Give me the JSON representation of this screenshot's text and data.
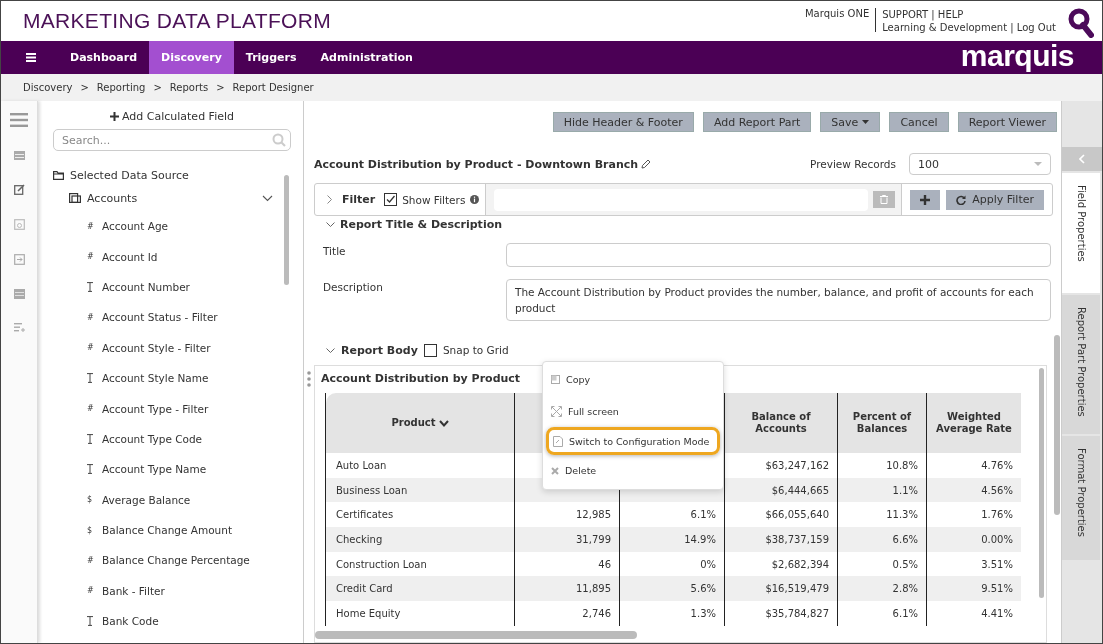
{
  "header": {
    "title": "MARKETING DATA PLATFORM",
    "user": "Marquis ONE",
    "links_top": "SUPPORT | HELP",
    "links_bottom": "Learning & Development | Log Out"
  },
  "nav": {
    "items": [
      {
        "label": "Dashboard",
        "selected": false
      },
      {
        "label": "Discovery",
        "selected": true
      },
      {
        "label": "Triggers",
        "selected": false
      },
      {
        "label": "Administration",
        "selected": false
      }
    ],
    "brand": "marquis"
  },
  "breadcrumb": [
    "Discovery",
    ">",
    "Reporting",
    ">",
    "Reports",
    ">",
    "Report Designer"
  ],
  "field_panel": {
    "add_button": "Add Calculated Field",
    "search": {
      "placeholder": "Search..."
    },
    "root": "Selected Data Source",
    "tables": [
      {
        "label": "Accounts",
        "expanded": true,
        "children": [
          {
            "icon": "#",
            "label": "Account Age",
            "kind": "symbol"
          },
          {
            "icon": "#",
            "label": "Account Id",
            "kind": "symbol"
          },
          {
            "label": "Account Number",
            "kind": "text"
          },
          {
            "icon": "#",
            "label": "Account Status - Filter",
            "kind": "symbol"
          },
          {
            "icon": "#",
            "label": "Account Style - Filter",
            "kind": "symbol"
          },
          {
            "label": "Account Style Name",
            "kind": "text"
          },
          {
            "icon": "#",
            "label": "Account Type - Filter",
            "kind": "symbol"
          },
          {
            "label": "Account Type Code",
            "kind": "text"
          },
          {
            "label": "Account Type Name",
            "kind": "text"
          },
          {
            "icon": "$",
            "label": "Average Balance",
            "kind": "symbol"
          },
          {
            "icon": "$",
            "label": "Balance Change Amount",
            "kind": "symbol"
          },
          {
            "icon": "#",
            "label": "Balance Change Percentage",
            "kind": "symbol"
          },
          {
            "icon": "#",
            "label": "Bank - Filter",
            "kind": "symbol"
          },
          {
            "label": "Bank Code",
            "kind": "text"
          }
        ]
      }
    ]
  },
  "toolbar": [
    "Hide Header & Footer",
    "Add Report Part",
    "Save",
    "Cancel",
    "Report Viewer"
  ],
  "report": {
    "name": "Account Distribution by Product - Downtown Branch",
    "preview_label": "Preview Records",
    "preview_value": "100"
  },
  "filter": {
    "label": "Filter",
    "show_filters": {
      "label": "Show Filters",
      "checked": true
    },
    "apply": "Apply Filter"
  },
  "title_section": {
    "heading": "Report Title & Description",
    "title_label": "Title",
    "description_label": "Description",
    "description": "The Account Distribution by Product provides the number, balance, and profit of accounts for each product"
  },
  "body_section": {
    "heading": "Report Body",
    "snap": {
      "label": "Snap to Grid",
      "checked": false
    }
  },
  "table": {
    "title": "Account Distribution by Product",
    "columns": [
      "Product",
      null,
      null,
      "Balance of Accounts",
      "Percent of Balances",
      "Weighted Average Rate"
    ],
    "rows": [
      [
        "Auto Loan",
        null,
        null,
        "$63,247,162",
        "10.8%",
        "4.76%"
      ],
      [
        "Business Loan",
        null,
        null,
        "$6,444,665",
        "1.1%",
        "4.56%"
      ],
      [
        "Certificates",
        "12,985",
        "6.1%",
        "$66,055,640",
        "11.3%",
        "1.76%"
      ],
      [
        "Checking",
        "31,799",
        "14.9%",
        "$38,737,159",
        "6.6%",
        "0.00%"
      ],
      [
        "Construction Loan",
        "46",
        "0%",
        "$2,682,394",
        "0.5%",
        "3.51%"
      ],
      [
        "Credit Card",
        "11,895",
        "5.6%",
        "$16,519,479",
        "2.8%",
        "9.51%"
      ],
      [
        "Home Equity",
        "2,746",
        "1.3%",
        "$35,784,827",
        "6.1%",
        "4.41%"
      ]
    ]
  },
  "context_menu": [
    {
      "label": "Copy",
      "kind": "copy",
      "selected": false
    },
    {
      "label": "Full screen",
      "kind": "fullscreen",
      "selected": false
    },
    {
      "label": "Switch to Configuration Mode",
      "kind": "config",
      "selected": true
    },
    {
      "label": "Delete",
      "kind": "delete",
      "selected": false
    }
  ],
  "side_tabs": [
    {
      "label": "Field Properties",
      "selected": true
    },
    {
      "label": "Report Part Properties",
      "selected": false
    },
    {
      "label": "Format Properties",
      "selected": false
    }
  ]
}
